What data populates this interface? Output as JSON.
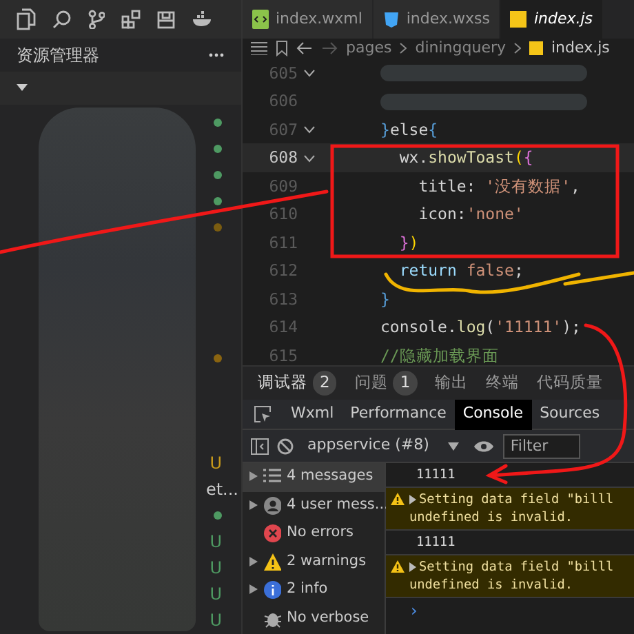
{
  "explorer": {
    "title": "资源管理器",
    "rows": [
      {
        "kind": "dot",
        "color": "#4e9a62"
      },
      {
        "kind": "dot",
        "color": "#4e9a62"
      },
      {
        "kind": "dot",
        "color": "#4e9a62"
      },
      {
        "kind": "dot",
        "color": "#4e9a62"
      },
      {
        "kind": "dot",
        "color": "#7a5c10"
      },
      {
        "kind": "blank"
      },
      {
        "kind": "blank"
      },
      {
        "kind": "blank"
      },
      {
        "kind": "blank"
      },
      {
        "kind": "dot",
        "color": "#8a6410"
      },
      {
        "kind": "blank"
      },
      {
        "kind": "blank"
      },
      {
        "kind": "blank"
      },
      {
        "kind": "letter",
        "text": "U",
        "color": "#c79a1a"
      },
      {
        "kind": "text",
        "text": "et..."
      },
      {
        "kind": "dot",
        "color": "#4e9a62"
      },
      {
        "kind": "letter",
        "text": "U",
        "color": "#4e9a62"
      },
      {
        "kind": "letter",
        "text": "U",
        "color": "#4e9a62"
      },
      {
        "kind": "letter",
        "text": "U",
        "color": "#4e9a62"
      },
      {
        "kind": "letter",
        "text": "U",
        "color": "#4e9a62"
      }
    ]
  },
  "tabs": [
    {
      "label": "index.wxml",
      "kind": "wxml",
      "selected": false
    },
    {
      "label": "index.wxss",
      "kind": "wxss",
      "selected": false
    },
    {
      "label": "index.js",
      "kind": "js",
      "selected": true
    }
  ],
  "breadcrumb": [
    "pages",
    "diningquery",
    "index.js"
  ],
  "code_lines": [
    {
      "number": "605",
      "fold": true,
      "current": false,
      "redacted": true
    },
    {
      "number": "606",
      "fold": false,
      "current": false,
      "redacted": true
    },
    {
      "number": "607",
      "fold": true,
      "current": false,
      "redacted": false,
      "tokens": [
        {
          "t": "}",
          "kind": "brace"
        },
        {
          "t": "else",
          "kind": "plain"
        },
        {
          "t": "{",
          "kind": "brace"
        }
      ]
    },
    {
      "number": "608",
      "fold": true,
      "current": true,
      "redacted": false,
      "tokens": [
        {
          "t": "  wx.",
          "kind": "plain"
        },
        {
          "t": "showToast",
          "kind": "func"
        },
        {
          "t": "(",
          "kind": "brace2"
        },
        {
          "t": "{",
          "kind": "brace3"
        }
      ]
    },
    {
      "number": "609",
      "fold": false,
      "current": false,
      "redacted": false,
      "tokens": [
        {
          "t": "    title: ",
          "kind": "plain"
        },
        {
          "t": "'没有数据'",
          "kind": "string"
        },
        {
          "t": ",",
          "kind": "plain"
        }
      ]
    },
    {
      "number": "610",
      "fold": false,
      "current": false,
      "redacted": false,
      "tokens": [
        {
          "t": "    icon:",
          "kind": "plain"
        },
        {
          "t": "'none'",
          "kind": "string"
        }
      ]
    },
    {
      "number": "611",
      "fold": false,
      "current": false,
      "redacted": false,
      "tokens": [
        {
          "t": "  }",
          "kind": "brace3"
        },
        {
          "t": ")",
          "kind": "brace2"
        }
      ]
    },
    {
      "number": "612",
      "fold": false,
      "current": false,
      "redacted": false,
      "tokens": [
        {
          "t": "  return ",
          "kind": "keyword"
        },
        {
          "t": "false",
          "kind": "string"
        },
        {
          "t": ";",
          "kind": "plain"
        }
      ]
    },
    {
      "number": "613",
      "fold": false,
      "current": false,
      "redacted": false,
      "tokens": [
        {
          "t": "}",
          "kind": "brace"
        }
      ]
    },
    {
      "number": "614",
      "fold": false,
      "current": false,
      "redacted": false,
      "tokens": [
        {
          "t": "console.",
          "kind": "plain"
        },
        {
          "t": "log",
          "kind": "func"
        },
        {
          "t": "(",
          "kind": "plain"
        },
        {
          "t": "'11111'",
          "kind": "string"
        },
        {
          "t": ");",
          "kind": "plain"
        }
      ]
    },
    {
      "number": "615",
      "fold": false,
      "current": false,
      "redacted": false,
      "tokens": [
        {
          "t": "//隐藏加载界面",
          "kind": "comment"
        }
      ]
    }
  ],
  "panel_tabs": [
    {
      "label": "调试器",
      "count": "2",
      "selected": true
    },
    {
      "label": "问题",
      "count": "1",
      "selected": false
    },
    {
      "label": "输出",
      "selected": false
    },
    {
      "label": "终端",
      "selected": false
    },
    {
      "label": "代码质量",
      "selected": false
    }
  ],
  "devtools_tabs": [
    {
      "label": "Wxml",
      "selected": false
    },
    {
      "label": "Performance",
      "selected": false
    },
    {
      "label": "Console",
      "selected": true
    },
    {
      "label": "Sources",
      "selected": false
    }
  ],
  "toolbar": {
    "context": "appservice (#8)",
    "filter": {
      "placeholder": "Filter"
    }
  },
  "console_sidebar": [
    {
      "label": "4 messages",
      "kind": "list",
      "expandable": true,
      "selected": true
    },
    {
      "label": "4 user mess...",
      "kind": "user",
      "expandable": true,
      "selected": false
    },
    {
      "label": "No errors",
      "kind": "error",
      "expandable": false,
      "selected": false
    },
    {
      "label": "2 warnings",
      "kind": "warning",
      "expandable": true,
      "selected": false
    },
    {
      "label": "2 info",
      "kind": "info",
      "expandable": true,
      "selected": false
    },
    {
      "label": "No verbose",
      "kind": "verbose",
      "expandable": false,
      "selected": false
    }
  ],
  "console_messages": [
    {
      "kind": "log",
      "lines": [
        "11111"
      ]
    },
    {
      "kind": "warning",
      "lines": [
        "Setting data field \"billl",
        "undefined is invalid."
      ]
    },
    {
      "kind": "log",
      "lines": [
        "11111"
      ]
    },
    {
      "kind": "warning",
      "lines": [
        "Setting data field \"billl",
        "undefined is invalid."
      ]
    }
  ],
  "prompt": "›"
}
